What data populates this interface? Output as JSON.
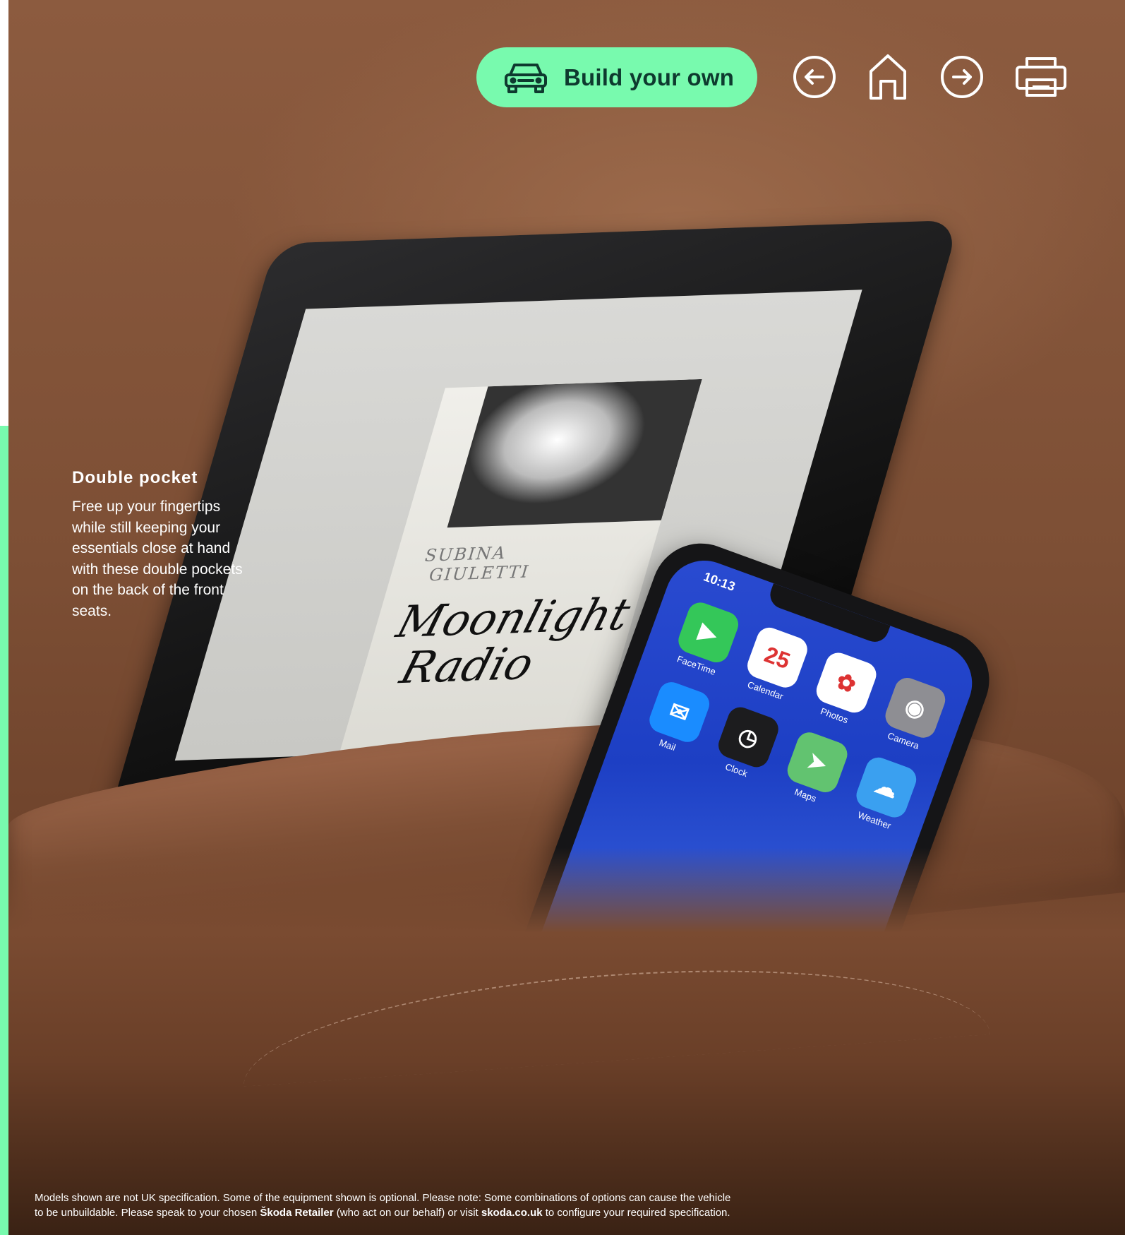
{
  "nav": {
    "build_label": "Build your own",
    "icons": [
      "car-icon",
      "arrow-left-icon",
      "home-icon",
      "arrow-right-icon",
      "print-icon"
    ],
    "accent_color": "#78faae",
    "text_color": "#0e3a2f"
  },
  "feature": {
    "title": "Double pocket",
    "body": "Free up your fingertips while still keeping your essentials close at hand with these double pockets on the back of the front seats."
  },
  "photo": {
    "book_author_1": "SUBINA",
    "book_author_2": "GIULETTI",
    "book_title_1": "Moonlight",
    "book_title_2": "Radio",
    "phone_time": "10:13",
    "apps": [
      {
        "label": "FaceTime",
        "glyph": "▶",
        "color": "#34c759"
      },
      {
        "label": "Calendar",
        "glyph": "25",
        "color": "#ffffff"
      },
      {
        "label": "Photos",
        "glyph": "✿",
        "color": "#ffffff"
      },
      {
        "label": "Camera",
        "glyph": "◉",
        "color": "#8e8e93"
      },
      {
        "label": "Mail",
        "glyph": "✉",
        "color": "#1a8cff"
      },
      {
        "label": "Clock",
        "glyph": "◷",
        "color": "#1c1c1e"
      },
      {
        "label": "Maps",
        "glyph": "➤",
        "color": "#62c370"
      },
      {
        "label": "Weather",
        "glyph": "☁",
        "color": "#3aa0f0"
      }
    ]
  },
  "footer": {
    "line1": "Models shown are not UK specification. Some of the equipment shown is optional. Please note: Some combinations of options can cause the vehicle",
    "line2_a": "to be unbuildable. Please speak to your chosen ",
    "line2_retailer": "Škoda Retailer",
    "line2_b": " (who act on our behalf) or visit ",
    "line2_site": "skoda.co.uk",
    "line2_c": " to configure your required specification."
  }
}
